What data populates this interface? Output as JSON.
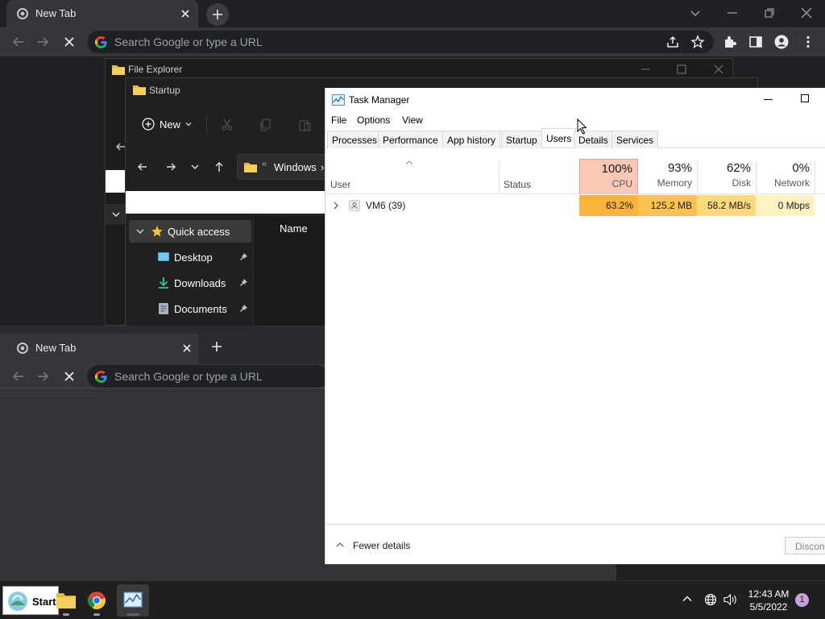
{
  "chrome_back": {
    "tab_title": "New Tab",
    "omnibox_placeholder": "Search Google or type a URL"
  },
  "file_explorer_back": {
    "title": "File Explorer"
  },
  "file_explorer": {
    "title": "Startup",
    "new_label": "New",
    "address_crumb": "Windows",
    "address_prefix": "«",
    "address_chevron": "›",
    "column_name": "Name",
    "nav_items": [
      {
        "label": "Quick access",
        "icon": "star-icon"
      },
      {
        "label": "Desktop",
        "icon": "desktop-icon"
      },
      {
        "label": "Downloads",
        "icon": "download-icon"
      },
      {
        "label": "Documents",
        "icon": "documents-icon"
      }
    ]
  },
  "chrome_front": {
    "tab_title": "New Tab",
    "omnibox_placeholder": "Search Google or type a URL"
  },
  "task_manager": {
    "title": "Task Manager",
    "menu": [
      "File",
      "Options",
      "View"
    ],
    "tabs": [
      "Processes",
      "Performance",
      "App history",
      "Startup",
      "Users",
      "Details",
      "Services"
    ],
    "active_tab": "Users",
    "columns": {
      "user": "User",
      "status": "Status",
      "cpu": {
        "percent": "100%",
        "label": "CPU"
      },
      "memory": {
        "percent": "93%",
        "label": "Memory"
      },
      "disk": {
        "percent": "62%",
        "label": "Disk"
      },
      "network": {
        "percent": "0%",
        "label": "Network"
      }
    },
    "rows": [
      {
        "name": "VM6 (39)",
        "status": "",
        "cpu": "63.2%",
        "memory": "125.2 MB",
        "disk": "58.2 MB/s",
        "network": "0 Mbps"
      }
    ],
    "footer": {
      "fewer_details": "Fewer details",
      "disconnect": "Disconnect"
    },
    "colors": {
      "cpu_header": "#f9c7b5",
      "cpu_cell": "#fbb33c",
      "memory_cell": "#fcc24f",
      "disk_cell": "#fdd97d",
      "network_cell": "#fff3c4"
    }
  },
  "taskbar": {
    "start_label": "Start",
    "time": "12:43 AM",
    "date": "5/5/2022",
    "notification_count": "1"
  }
}
